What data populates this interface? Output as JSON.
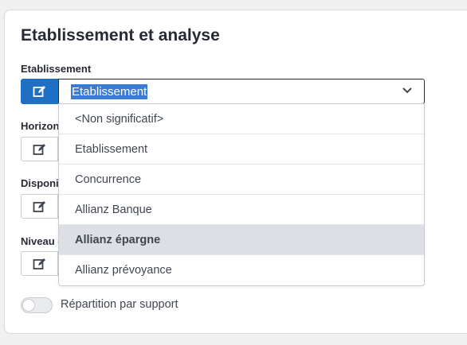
{
  "card": {
    "title": "Etablissement et analyse"
  },
  "fields": [
    {
      "label": "Etablissement"
    },
    {
      "label": "Horizon"
    },
    {
      "label": "Disponibilité"
    },
    {
      "label": "Niveau de"
    }
  ],
  "select": {
    "value": "Etablissement"
  },
  "dropdown": {
    "options": [
      "<Non significatif>",
      "Etablissement",
      "Concurrence",
      "Allianz Banque",
      "Allianz épargne",
      "Allianz prévoyance"
    ],
    "hovered": "Allianz épargne"
  },
  "toggle": {
    "label": "Répartition par support",
    "on": false
  },
  "colors": {
    "accent": "#1f6fc5",
    "selection": "#3a7bd5",
    "hover_row": "#dcdfe3"
  }
}
